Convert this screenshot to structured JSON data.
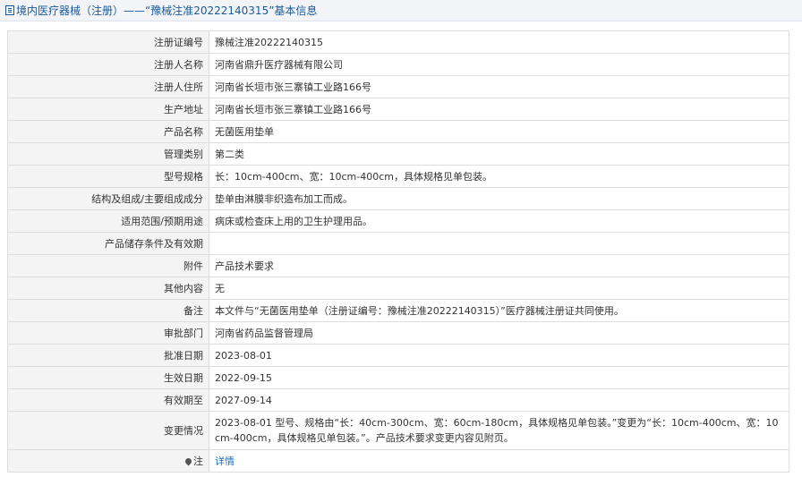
{
  "header": {
    "title": "境内医疗器械（注册）——“豫械注准20222140315”基本信息"
  },
  "rows": [
    {
      "label": "注册证编号",
      "value": "豫械注准20222140315"
    },
    {
      "label": "注册人名称",
      "value": "河南省鼎升医疗器械有限公司"
    },
    {
      "label": "注册人住所",
      "value": "河南省长垣市张三寨镇工业路166号"
    },
    {
      "label": "生产地址",
      "value": "河南省长垣市张三寨镇工业路166号"
    },
    {
      "label": "产品名称",
      "value": "无菌医用垫单"
    },
    {
      "label": "管理类别",
      "value": "第二类"
    },
    {
      "label": "型号规格",
      "value": "长：10cm-400cm、宽：10cm-400cm，具体规格见单包装。"
    },
    {
      "label": "结构及组成/主要组成成分",
      "value": "垫单由淋膜非织造布加工而成。"
    },
    {
      "label": "适用范围/预期用途",
      "value": "病床或检查床上用的卫生护理用品。"
    },
    {
      "label": "产品储存条件及有效期",
      "value": ""
    },
    {
      "label": "附件",
      "value": "产品技术要求"
    },
    {
      "label": "其他内容",
      "value": "无"
    },
    {
      "label": "备注",
      "value": "本文件与“无菌医用垫单（注册证编号：豫械注准20222140315）”医疗器械注册证共同使用。"
    },
    {
      "label": "审批部门",
      "value": "河南省药品监督管理局"
    },
    {
      "label": "批准日期",
      "value": "2023-08-01"
    },
    {
      "label": "生效日期",
      "value": "2022-09-15"
    },
    {
      "label": "有效期至",
      "value": "2027-09-14"
    },
    {
      "label": "变更情况",
      "value": "2023-08-01 型号、规格由“长：40cm-300cm、宽：60cm-180cm，具体规格见单包装。”变更为“长：10cm-400cm、宽：10cm-400cm，具体规格见单包装。”。产品技术要求变更内容见附页。"
    }
  ],
  "note": {
    "label": "注",
    "link": "详情"
  },
  "colors": {
    "accent": "#1a5a9a",
    "link": "#1a6fc0",
    "label_bg": "#f4f4f4",
    "border": "#dddddd"
  }
}
